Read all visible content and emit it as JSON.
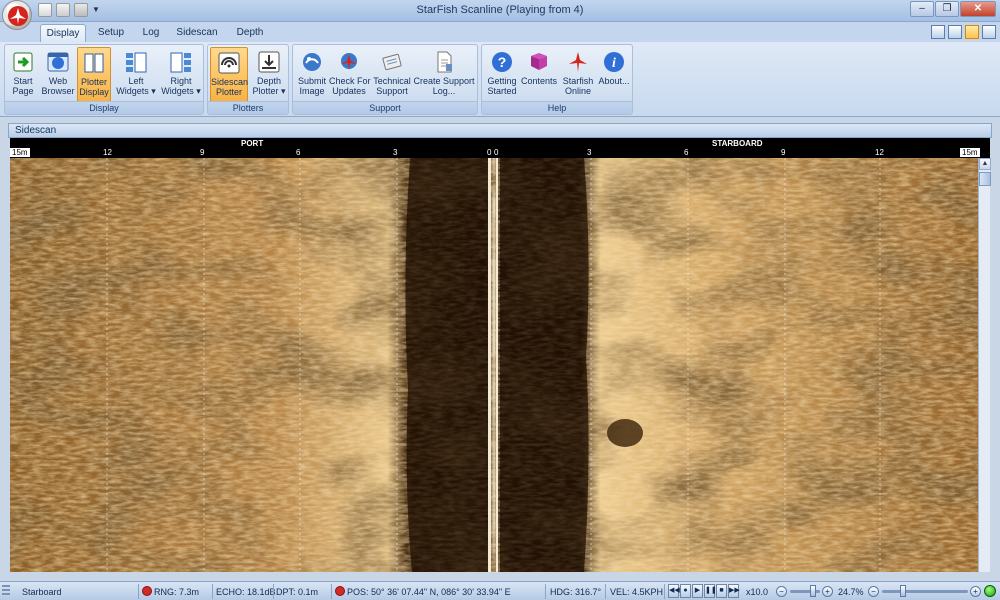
{
  "window": {
    "title": "StarFish Scanline (Playing from 4)",
    "controls": {
      "minimize": "–",
      "restore": "❐",
      "close": "✕"
    }
  },
  "tabs": [
    "Display",
    "Setup",
    "Log",
    "Sidescan",
    "Depth"
  ],
  "active_tab": "Display",
  "ribbon": {
    "groups": [
      {
        "label": "Display",
        "buttons": [
          {
            "line1": "Start",
            "line2": "Page",
            "icon": "start-page-icon"
          },
          {
            "line1": "Web",
            "line2": "Browser",
            "icon": "web-browser-icon"
          },
          {
            "line1": "Plotter",
            "line2": "Display",
            "icon": "plotter-display-icon",
            "pressed": true
          },
          {
            "line1": "Left",
            "line2": "Widgets ▾",
            "icon": "left-widgets-icon"
          },
          {
            "line1": "Right",
            "line2": "Widgets ▾",
            "icon": "right-widgets-icon"
          }
        ]
      },
      {
        "label": "Plotters",
        "buttons": [
          {
            "line1": "Sidescan",
            "line2": "Plotter",
            "icon": "sidescan-plotter-icon",
            "pressed": true
          },
          {
            "line1": "Depth",
            "line2": "Plotter ▾",
            "icon": "depth-plotter-icon"
          }
        ]
      },
      {
        "label": "Support",
        "buttons": [
          {
            "line1": "Submit",
            "line2": "Image",
            "icon": "submit-image-icon"
          },
          {
            "line1": "Check For",
            "line2": "Updates",
            "icon": "check-updates-icon"
          },
          {
            "line1": "Technical",
            "line2": "Support",
            "icon": "technical-support-icon"
          },
          {
            "line1": "Create Support",
            "line2": "Log...",
            "icon": "create-support-log-icon"
          }
        ]
      },
      {
        "label": "Help",
        "buttons": [
          {
            "line1": "Getting",
            "line2": "Started",
            "icon": "getting-started-icon"
          },
          {
            "line1": "Contents",
            "line2": "",
            "icon": "contents-icon"
          },
          {
            "line1": "Starfish",
            "line2": "Online",
            "icon": "starfish-online-icon"
          },
          {
            "line1": "About...",
            "line2": "",
            "icon": "about-icon"
          }
        ]
      }
    ]
  },
  "sidescan": {
    "panel_title": "Sidescan",
    "port_label": "PORT",
    "starboard_label": "STARBOARD",
    "range_left": "15m",
    "range_right": "15m",
    "port_ticks": [
      "12",
      "9",
      "6",
      "3",
      "0"
    ],
    "starboard_ticks": [
      "0",
      "3",
      "6",
      "9",
      "12"
    ]
  },
  "statusbar": {
    "channel": "Starboard",
    "range": "RNG: 7.3m",
    "echo": "ECHO: 18.1dB",
    "depth": "DPT: 0.1m",
    "position": "POS: 50° 36' 07.44\" N, 086° 30' 33.94\" E",
    "heading": "HDG: 316.7°",
    "velocity": "VEL: 4.5KPH",
    "speed": "x10.0",
    "zoom": "24.7%"
  },
  "colors": {
    "sonar_dark": "#2a1705",
    "sonar_mid": "#8a5a22",
    "sonar_bright": "#e6b972",
    "ribbon_pressed": "#f8b244"
  }
}
